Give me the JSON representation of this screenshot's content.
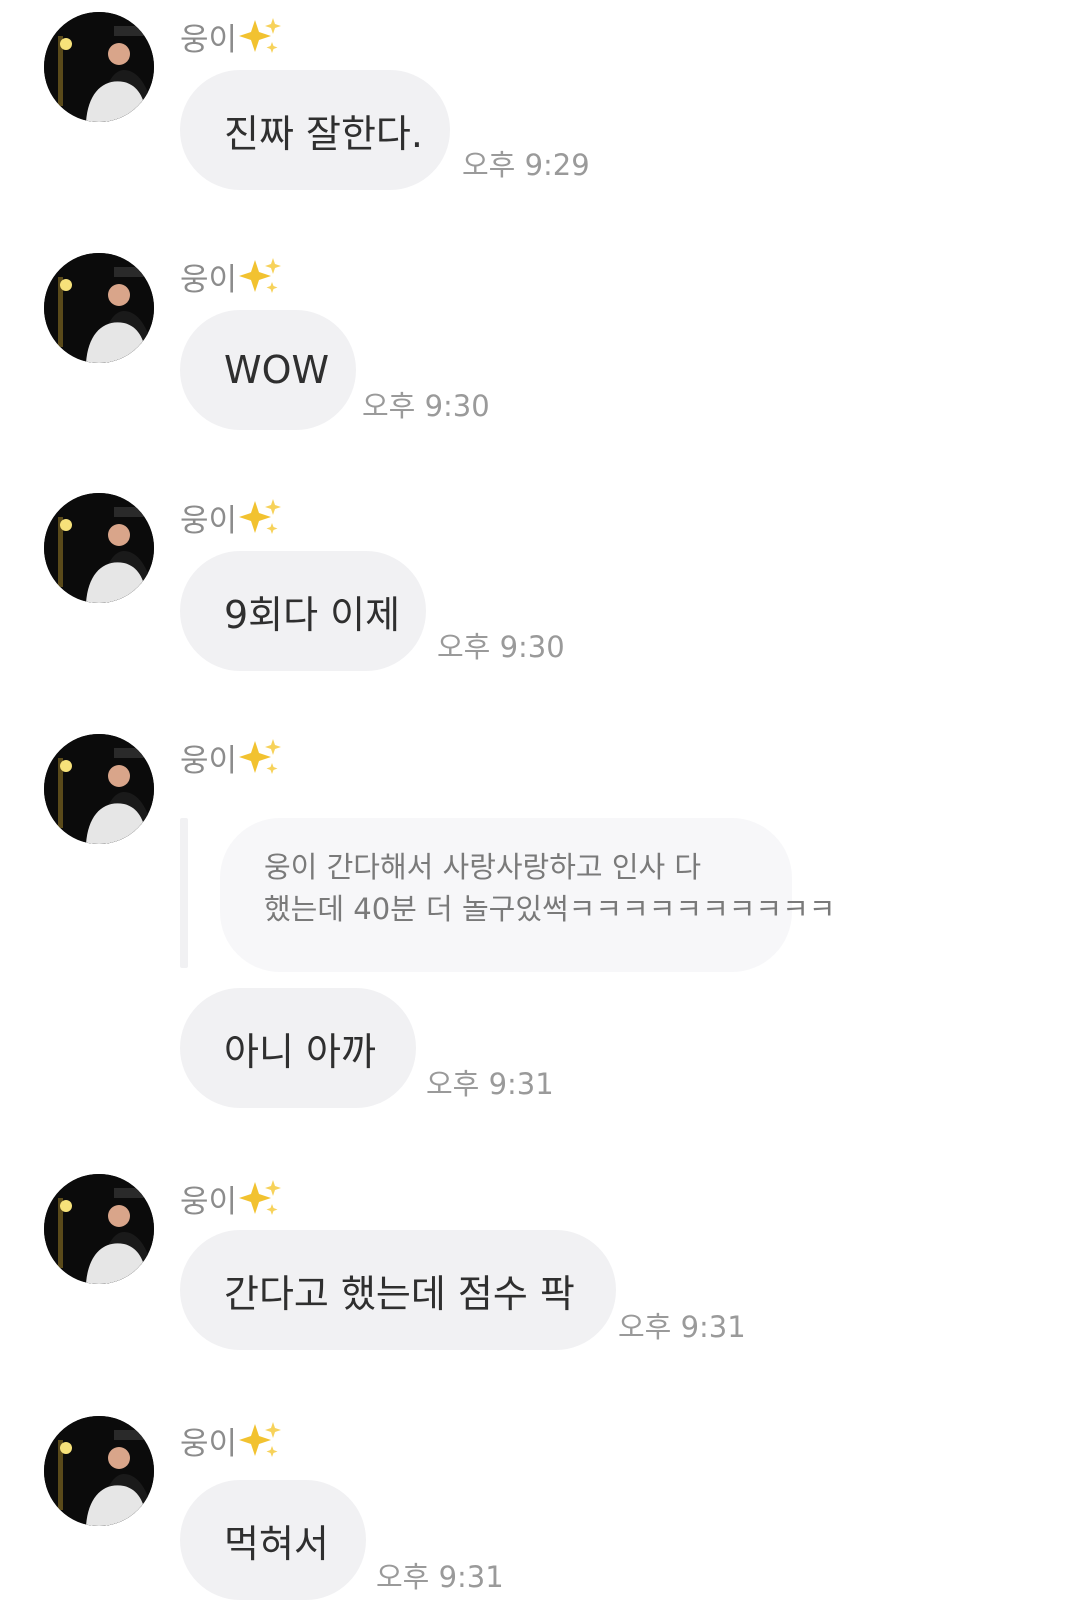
{
  "chat": {
    "sender_name": "웅이",
    "sender_emoji": "sparkles-icon",
    "messages": [
      {
        "text": "진짜 잘한다.",
        "time": "오후 9:29"
      },
      {
        "text": "WOW",
        "time": "오후 9:30"
      },
      {
        "text": "9회다 이제",
        "time": "오후 9:30"
      },
      {
        "quote_lines": [
          "웅이 간다해서 사랑사랑하고 인사 다",
          "했는데 40분 더 놀구있썩ㅋㅋㅋㅋㅋㅋㅋㅋㅋㅋ"
        ],
        "text": "아니 아까",
        "time": "오후 9:31"
      },
      {
        "text": "간다고 했는데 점수 팍",
        "time": "오후 9:31"
      },
      {
        "text": "먹혀서",
        "time": "오후 9:31"
      }
    ]
  },
  "colors": {
    "bubble": "#f1f1f3",
    "quote_bubble": "#f7f7f9",
    "time_text": "#9a9a9a",
    "sender_text": "#8c8c8c"
  }
}
